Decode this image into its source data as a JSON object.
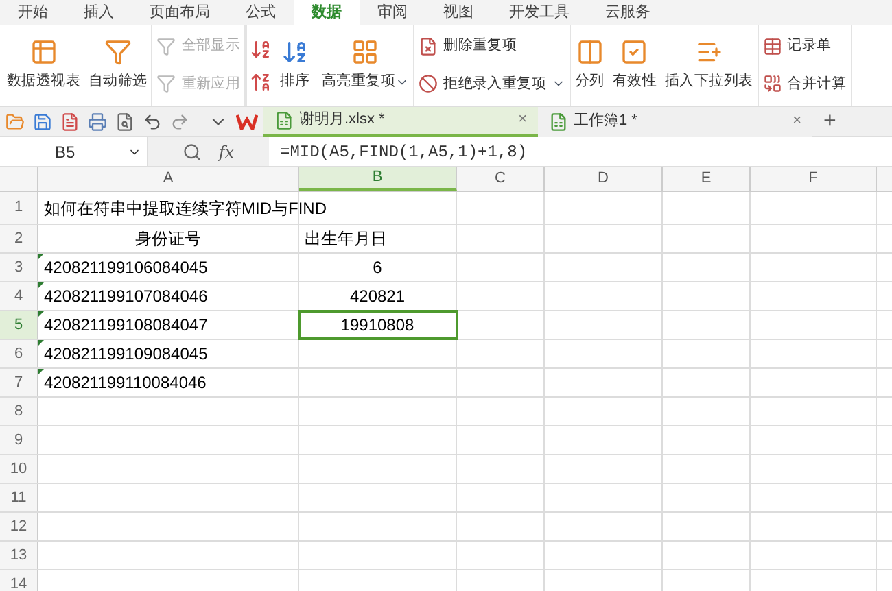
{
  "menu_tabs": [
    {
      "label": "开始",
      "selected": false
    },
    {
      "label": "插入",
      "selected": false
    },
    {
      "label": "页面布局",
      "selected": false
    },
    {
      "label": "公式",
      "selected": false
    },
    {
      "label": "数据",
      "selected": true
    },
    {
      "label": "审阅",
      "selected": false
    },
    {
      "label": "视图",
      "selected": false
    },
    {
      "label": "开发工具",
      "selected": false
    },
    {
      "label": "云服务",
      "selected": false
    }
  ],
  "ribbon": [
    {
      "kind": "big",
      "label": "数据透视表"
    },
    {
      "kind": "big",
      "label": "自动筛选"
    },
    {
      "kind": "stack",
      "items": [
        {
          "label": "全部显示",
          "disabled": true
        },
        {
          "label": "重新应用",
          "disabled": true
        }
      ]
    },
    {
      "kind": "sort",
      "label": "排序"
    },
    {
      "kind": "big",
      "label": "高亮重复项",
      "dropdown": true
    },
    {
      "kind": "stack",
      "items": [
        {
          "label": "删除重复项",
          "disabled": false
        },
        {
          "label": "拒绝录入重复项",
          "disabled": false,
          "dropdown": true
        }
      ]
    },
    {
      "kind": "big",
      "label": "分列"
    },
    {
      "kind": "big",
      "label": "有效性"
    },
    {
      "kind": "big",
      "label": "插入下拉列表"
    },
    {
      "kind": "stack",
      "items": [
        {
          "label": "记录单",
          "disabled": false
        },
        {
          "label": "合并计算",
          "disabled": false
        }
      ]
    }
  ],
  "doc_tabs": [
    {
      "label": "谢明月.xlsx *",
      "close": "×",
      "selected": true
    },
    {
      "label": "工作簿1 *",
      "close": "×",
      "selected": false
    }
  ],
  "new_tab": "+",
  "formula_bar": {
    "name_box": "B5",
    "fx": "fx",
    "formula": "=MID(A5,FIND(1,A5,1)+1,8)"
  },
  "columns": [
    {
      "label": "A",
      "selected": false
    },
    {
      "label": "B",
      "selected": true
    },
    {
      "label": "C",
      "selected": false
    },
    {
      "label": "D",
      "selected": false
    },
    {
      "label": "E",
      "selected": false
    },
    {
      "label": "F",
      "selected": false
    }
  ],
  "rows": [
    {
      "number": "1",
      "selected": false,
      "cells": [
        {
          "text": "如何在符串中提取连续字符MID与FIND",
          "centered": false
        }
      ]
    },
    {
      "number": "2",
      "selected": false,
      "cells": [
        {
          "text": "身份证号",
          "centered": true
        },
        {
          "text": "出生年月日",
          "centered": false
        }
      ]
    },
    {
      "number": "3",
      "selected": false,
      "cells": [
        {
          "text": "420821199106084045",
          "centered": false,
          "marked": true
        },
        {
          "text": "6",
          "centered": true
        }
      ]
    },
    {
      "number": "4",
      "selected": false,
      "cells": [
        {
          "text": "420821199107084046",
          "centered": false,
          "marked": true
        },
        {
          "text": "420821",
          "centered": true
        }
      ]
    },
    {
      "number": "5",
      "selected": true,
      "cells": [
        {
          "text": "420821199108084047",
          "centered": false,
          "marked": true
        },
        {
          "text": "19910808",
          "centered": true,
          "selected": true
        }
      ]
    },
    {
      "number": "6",
      "selected": false,
      "cells": [
        {
          "text": "420821199109084045",
          "centered": false,
          "marked": true
        }
      ]
    },
    {
      "number": "7",
      "selected": false,
      "cells": [
        {
          "text": "420821199110084046",
          "centered": false,
          "marked": true
        }
      ]
    },
    {
      "number": "8",
      "selected": false,
      "cells": []
    },
    {
      "number": "9",
      "selected": false,
      "cells": []
    },
    {
      "number": "10",
      "selected": false,
      "cells": []
    },
    {
      "number": "11",
      "selected": false,
      "cells": []
    },
    {
      "number": "12",
      "selected": false,
      "cells": []
    },
    {
      "number": "13",
      "selected": false,
      "cells": []
    },
    {
      "number": "14",
      "selected": false,
      "cells": []
    }
  ]
}
